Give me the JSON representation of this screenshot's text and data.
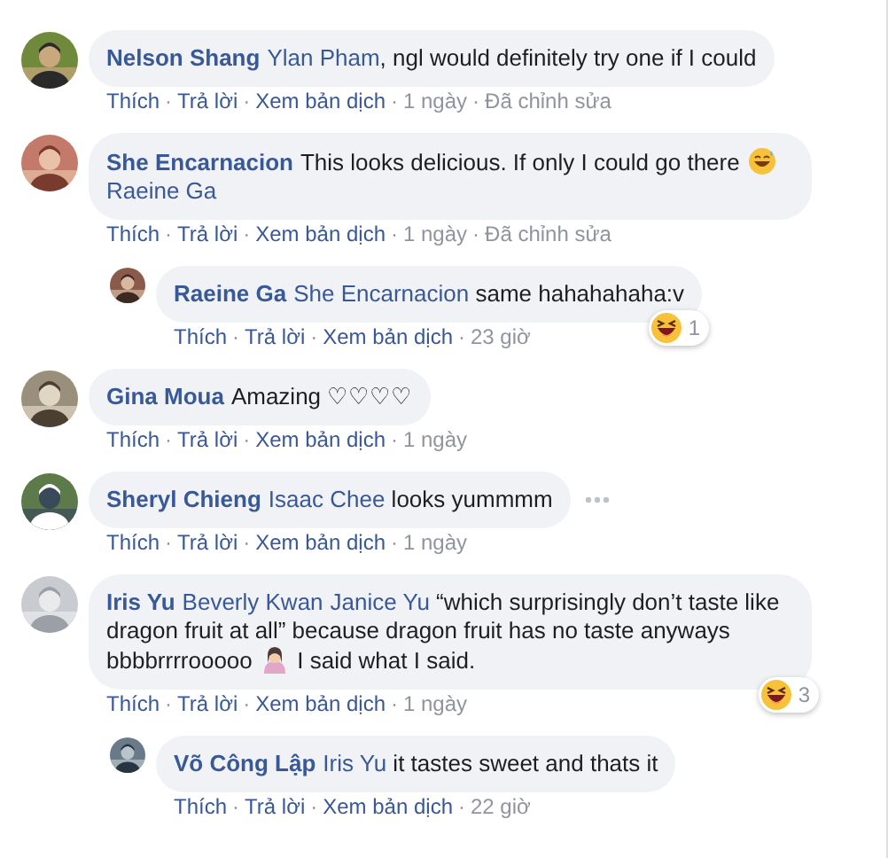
{
  "separator": "·",
  "comments": [
    {
      "author": "Nelson Shang",
      "body": [
        {
          "kind": "mention",
          "text": "Ylan Pham"
        },
        {
          "kind": "text",
          "text": ", ngl would definitely try one if I could"
        }
      ],
      "actions": [
        "Thích",
        "Trả lời",
        "Xem bản dịch"
      ],
      "time": "1 ngày",
      "edited": "Đã chỉnh sửa",
      "more_menu": false
    },
    {
      "author": "She Encarnacion",
      "body": [
        {
          "kind": "text",
          "text": "This looks delicious. If only I could go there "
        },
        {
          "kind": "sweat-smile-emoji"
        },
        {
          "kind": "mention",
          "text": "Raeine Ga"
        }
      ],
      "actions": [
        "Thích",
        "Trả lời",
        "Xem bản dịch"
      ],
      "time": "1 ngày",
      "edited": "Đã chỉnh sửa",
      "more_menu": false,
      "replies": [
        {
          "author": "Raeine Ga",
          "body": [
            {
              "kind": "mention",
              "text": "She Encarnacion"
            },
            {
              "kind": "text",
              "text": " same hahahahaha:v"
            }
          ],
          "actions": [
            "Thích",
            "Trả lời",
            "Xem bản dịch"
          ],
          "time": "23 giờ",
          "reaction": {
            "count": "1"
          },
          "more_menu": false
        }
      ]
    },
    {
      "author": "Gina Moua",
      "body": [
        {
          "kind": "text",
          "text": "Amazing ♡♡♡♡"
        }
      ],
      "actions": [
        "Thích",
        "Trả lời",
        "Xem bản dịch"
      ],
      "time": "1 ngày",
      "more_menu": false
    },
    {
      "author": "Sheryl Chieng",
      "body": [
        {
          "kind": "mention",
          "text": "Isaac Chee"
        },
        {
          "kind": "text",
          "text": " looks yummmm"
        }
      ],
      "actions": [
        "Thích",
        "Trả lời",
        "Xem bản dịch"
      ],
      "time": "1 ngày",
      "more_menu": true
    },
    {
      "author": "Iris Yu",
      "body": [
        {
          "kind": "mention",
          "text": "Beverly Kwan"
        },
        {
          "kind": "mention",
          "text": "Janice Yu"
        },
        {
          "kind": "text",
          "text": " “which surprisingly don’t taste like dragon fruit at all” because dragon fruit has no taste anyways bbbbrrrrooooo "
        },
        {
          "kind": "person-emoji"
        },
        {
          "kind": "text",
          "text": " I said what I said."
        }
      ],
      "actions": [
        "Thích",
        "Trả lời",
        "Xem bản dịch"
      ],
      "time": "1 ngày",
      "reaction": {
        "count": "3"
      },
      "more_menu": false,
      "replies": [
        {
          "author": "Võ Công Lập",
          "body": [
            {
              "kind": "mention",
              "text": "Iris Yu"
            },
            {
              "kind": "text",
              "text": " it tastes sweet and thats it"
            }
          ],
          "actions": [
            "Thích",
            "Trả lời",
            "Xem bản dịch"
          ],
          "time": "22 giờ",
          "more_menu": false
        }
      ]
    }
  ]
}
